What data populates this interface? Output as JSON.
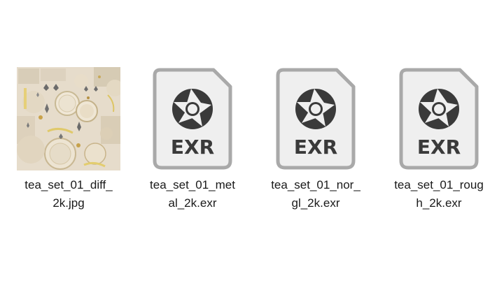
{
  "files": [
    {
      "name_line1": "tea_set_01_diff_",
      "name_line2": "2k.jpg",
      "type": "jpg",
      "icon": "image-thumbnail"
    },
    {
      "name_line1": "tea_set_01_met",
      "name_line2": "al_2k.exr",
      "type": "exr",
      "badge": "EXR",
      "icon": "aperture-icon"
    },
    {
      "name_line1": "tea_set_01_nor_",
      "name_line2": "gl_2k.exr",
      "type": "exr",
      "badge": "EXR",
      "icon": "aperture-icon"
    },
    {
      "name_line1": "tea_set_01_roug",
      "name_line2": "h_2k.exr",
      "type": "exr",
      "badge": "EXR",
      "icon": "aperture-icon"
    }
  ],
  "colors": {
    "icon_border": "#a9a9a9",
    "icon_fill": "#efefef",
    "icon_glyph": "#3a3a3a",
    "label_text": "#1a1a1a"
  }
}
